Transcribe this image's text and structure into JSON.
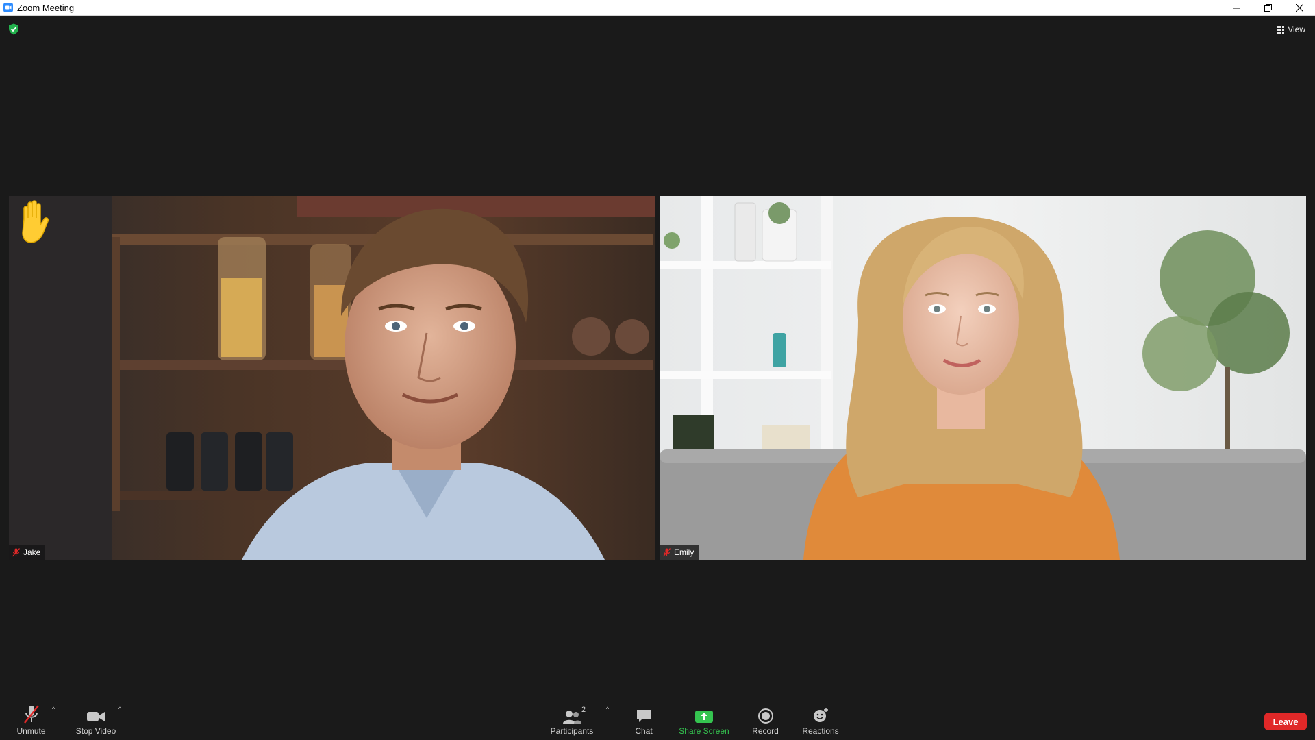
{
  "window": {
    "title": "Zoom Meeting",
    "icon": "zoom-app-icon",
    "controls": [
      "minimize-icon",
      "restore-icon",
      "close-icon"
    ]
  },
  "meeting": {
    "encryption_icon": "shield-check-icon",
    "view_label": "View"
  },
  "participants": [
    {
      "name": "Jake",
      "muted": true,
      "hand_raised": true
    },
    {
      "name": "Emily",
      "muted": true,
      "hand_raised": false
    }
  ],
  "toolbar": {
    "unmute_label": "Unmute",
    "stop_video_label": "Stop Video",
    "participants_label": "Participants",
    "participants_count": "2",
    "chat_label": "Chat",
    "share_screen_label": "Share Screen",
    "record_label": "Record",
    "reactions_label": "Reactions",
    "leave_label": "Leave"
  },
  "colors": {
    "background": "#1a1a1a",
    "share_green": "#35c450",
    "leave_red": "#e02828",
    "zoom_blue": "#2d8cff",
    "muted_red": "#e02828"
  }
}
